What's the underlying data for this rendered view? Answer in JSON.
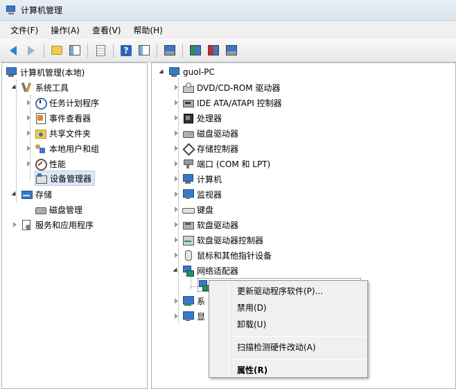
{
  "window": {
    "title": "计算机管理"
  },
  "menubar": {
    "items": [
      "文件(F)",
      "操作(A)",
      "查看(V)",
      "帮助(H)"
    ]
  },
  "toolbar": {
    "buttons": [
      "back-icon",
      "forward-icon",
      "up-folder-icon",
      "show-hide-tree-icon",
      "export-list-icon",
      "help-icon",
      "action-pane-icon",
      "scan-hardware-icon",
      "update-driver-icon",
      "disable-device-icon",
      "uninstall-device-icon"
    ]
  },
  "left_tree": {
    "root": "计算机管理(本地)",
    "system_tools": "系统工具",
    "task_scheduler": "任务计划程序",
    "event_viewer": "事件查看器",
    "shared_folders": "共享文件夹",
    "local_users": "本地用户和组",
    "performance": "性能",
    "device_manager": "设备管理器",
    "storage": "存储",
    "disk_management": "磁盘管理",
    "services_apps": "服务和应用程序"
  },
  "device_tree": {
    "root": "guol-PC",
    "categories": {
      "dvd": "DVD/CD-ROM 驱动器",
      "ide": "IDE ATA/ATAPI 控制器",
      "cpu": "处理器",
      "disk": "磁盘驱动器",
      "storage": "存储控制器",
      "ports": "端口 (COM 和 LPT)",
      "computer": "计算机",
      "monitors": "监视器",
      "keyboards": "键盘",
      "floppy": "软盘驱动器",
      "floppy_ctrl": "软盘驱动器控制器",
      "mice": "鼠标和其他指针设备",
      "network": "网络适配器",
      "system_partial": "系",
      "display_partial": "显"
    }
  },
  "context_menu": {
    "update_driver": "更新驱动程序软件(P)...",
    "disable": "禁用(D)",
    "uninstall": "卸载(U)",
    "scan": "扫描检测硬件改动(A)",
    "properties": "属性(R)"
  }
}
